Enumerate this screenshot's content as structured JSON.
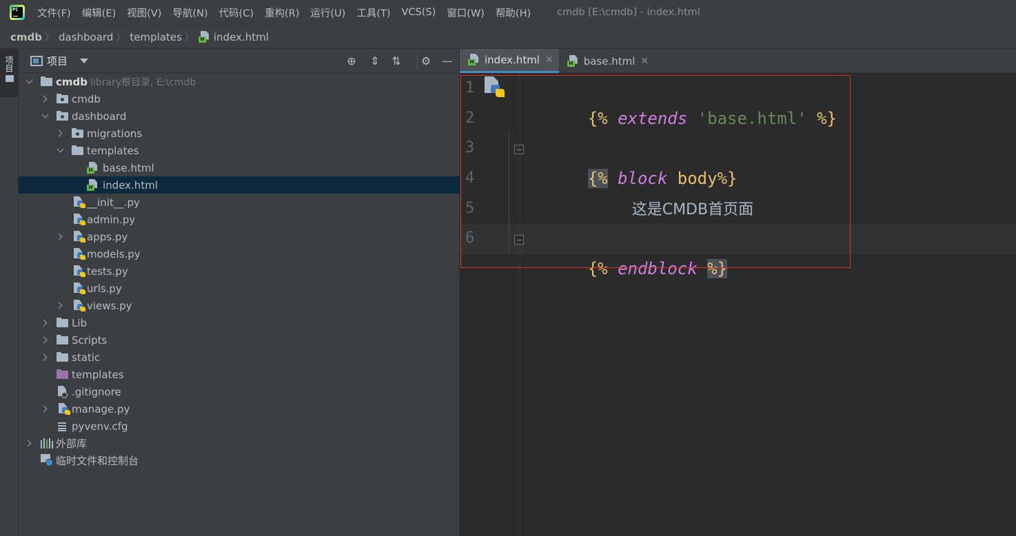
{
  "menubar": {
    "items": [
      "文件(F)",
      "编辑(E)",
      "视图(V)",
      "导航(N)",
      "代码(C)",
      "重构(R)",
      "运行(U)",
      "工具(T)",
      "VCS(S)",
      "窗口(W)",
      "帮助(H)"
    ],
    "window_title": "cmdb [E:\\cmdb] - index.html",
    "logo_text": "PC"
  },
  "breadcrumb": [
    "cmdb",
    "dashboard",
    "templates",
    "index.html"
  ],
  "tool_stripe": {
    "project_label": "项目"
  },
  "project_panel": {
    "title": "项目",
    "tree": {
      "root": {
        "name": "cmdb",
        "hint": "library根目录, E:\\cmdb"
      },
      "cmdb_pkg": "cmdb",
      "dashboard": "dashboard",
      "migrations": "migrations",
      "templates_inner": "templates",
      "base_html": "base.html",
      "index_html": "index.html",
      "init_py": "__init__.py",
      "admin_py": "admin.py",
      "apps_py": "apps.py",
      "models_py": "models.py",
      "tests_py": "tests.py",
      "urls_py": "urls.py",
      "views_py": "views.py",
      "lib": "Lib",
      "scripts": "Scripts",
      "static": "static",
      "templates_root": "templates",
      "gitignore": ".gitignore",
      "manage_py": "manage.py",
      "pyvenv_cfg": "pyvenv.cfg",
      "external_libs": "外部库",
      "scratches": "临时文件和控制台"
    }
  },
  "editor": {
    "tabs": [
      {
        "label": "index.html",
        "active": true
      },
      {
        "label": "base.html",
        "active": false
      }
    ],
    "line_numbers": [
      "1",
      "2",
      "3",
      "4",
      "5",
      "6"
    ],
    "code": {
      "l1_open": "{%",
      "l1_kw": "extends",
      "l1_str": "'base.html'",
      "l1_close": "%}",
      "l3_open": "{%",
      "l3_kw": "block",
      "l3_name": "body",
      "l3_close": "%}",
      "l4_text": "这是CMDB首页面",
      "l6_open": "{%",
      "l6_kw": "endblock",
      "l6_close": "%}"
    }
  },
  "colors": {
    "selection": "#0d293e",
    "keyword": "#cc7fe0",
    "delimiter": "#e8bf6a",
    "string": "#6a8759",
    "highlight_box": "#d9342b"
  }
}
